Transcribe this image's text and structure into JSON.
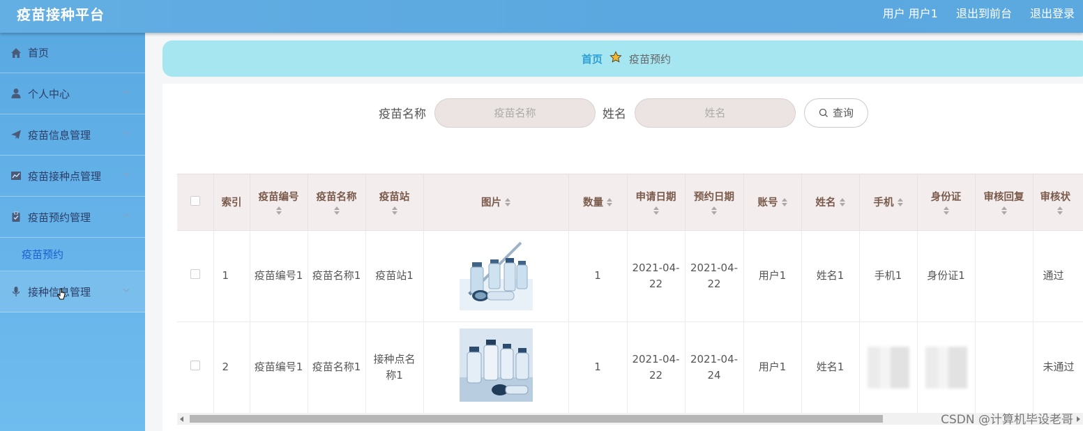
{
  "header": {
    "title": "疫苗接种平台",
    "user_label": "用户 用户1",
    "front_link": "退出到前台",
    "logout_link": "退出登录"
  },
  "sidebar": {
    "items": [
      {
        "label": "首页",
        "icon": "home-icon"
      },
      {
        "label": "个人中心",
        "icon": "user-icon"
      },
      {
        "label": "疫苗信息管理",
        "icon": "paper-plane-icon"
      },
      {
        "label": "疫苗接种点管理",
        "icon": "chart-icon"
      },
      {
        "label": "疫苗预约管理",
        "icon": "clipboard-icon",
        "expanded": true,
        "children": [
          {
            "label": "疫苗预约"
          }
        ]
      },
      {
        "label": "接种信息管理",
        "icon": "microphone-icon"
      }
    ]
  },
  "breadcrumb": {
    "home": "首页",
    "current": "疫苗预约"
  },
  "search": {
    "vaccine_label": "疫苗名称",
    "vaccine_placeholder": "疫苗名称",
    "name_label": "姓名",
    "name_placeholder": "姓名",
    "query_button": "查询"
  },
  "table": {
    "columns": [
      "索引",
      "疫苗编号",
      "疫苗名称",
      "疫苗站",
      "图片",
      "数量",
      "申请日期",
      "预约日期",
      "账号",
      "姓名",
      "手机",
      "身份证",
      "审核回复",
      "审核状"
    ],
    "rows": [
      {
        "index": "1",
        "vaccine_no": "疫苗编号1",
        "vaccine_name": "疫苗名称1",
        "station": "疫苗站1",
        "qty": "1",
        "apply_date": "2021-04-22",
        "book_date": "2021-04-22",
        "account": "用户1",
        "name": "姓名1",
        "phone": "手机1",
        "id_card": "身份证1",
        "reply": "",
        "status": "通过"
      },
      {
        "index": "2",
        "vaccine_no": "疫苗编号1",
        "vaccine_name": "疫苗名称1",
        "station": "接种点名称1",
        "qty": "1",
        "apply_date": "2021-04-22",
        "book_date": "2021-04-24",
        "account": "用户1",
        "name": "姓名1",
        "phone": "",
        "id_card": "",
        "reply": "",
        "status": "未通过"
      }
    ]
  },
  "watermark": "CSDN @计算机毕设老哥",
  "colors": {
    "header": "#5ca9e0",
    "sidebar": "#6fbcef",
    "breadcrumb": "#a6e6f0",
    "table_header": "#f3eded",
    "accent_link": "#1a5fd0"
  }
}
